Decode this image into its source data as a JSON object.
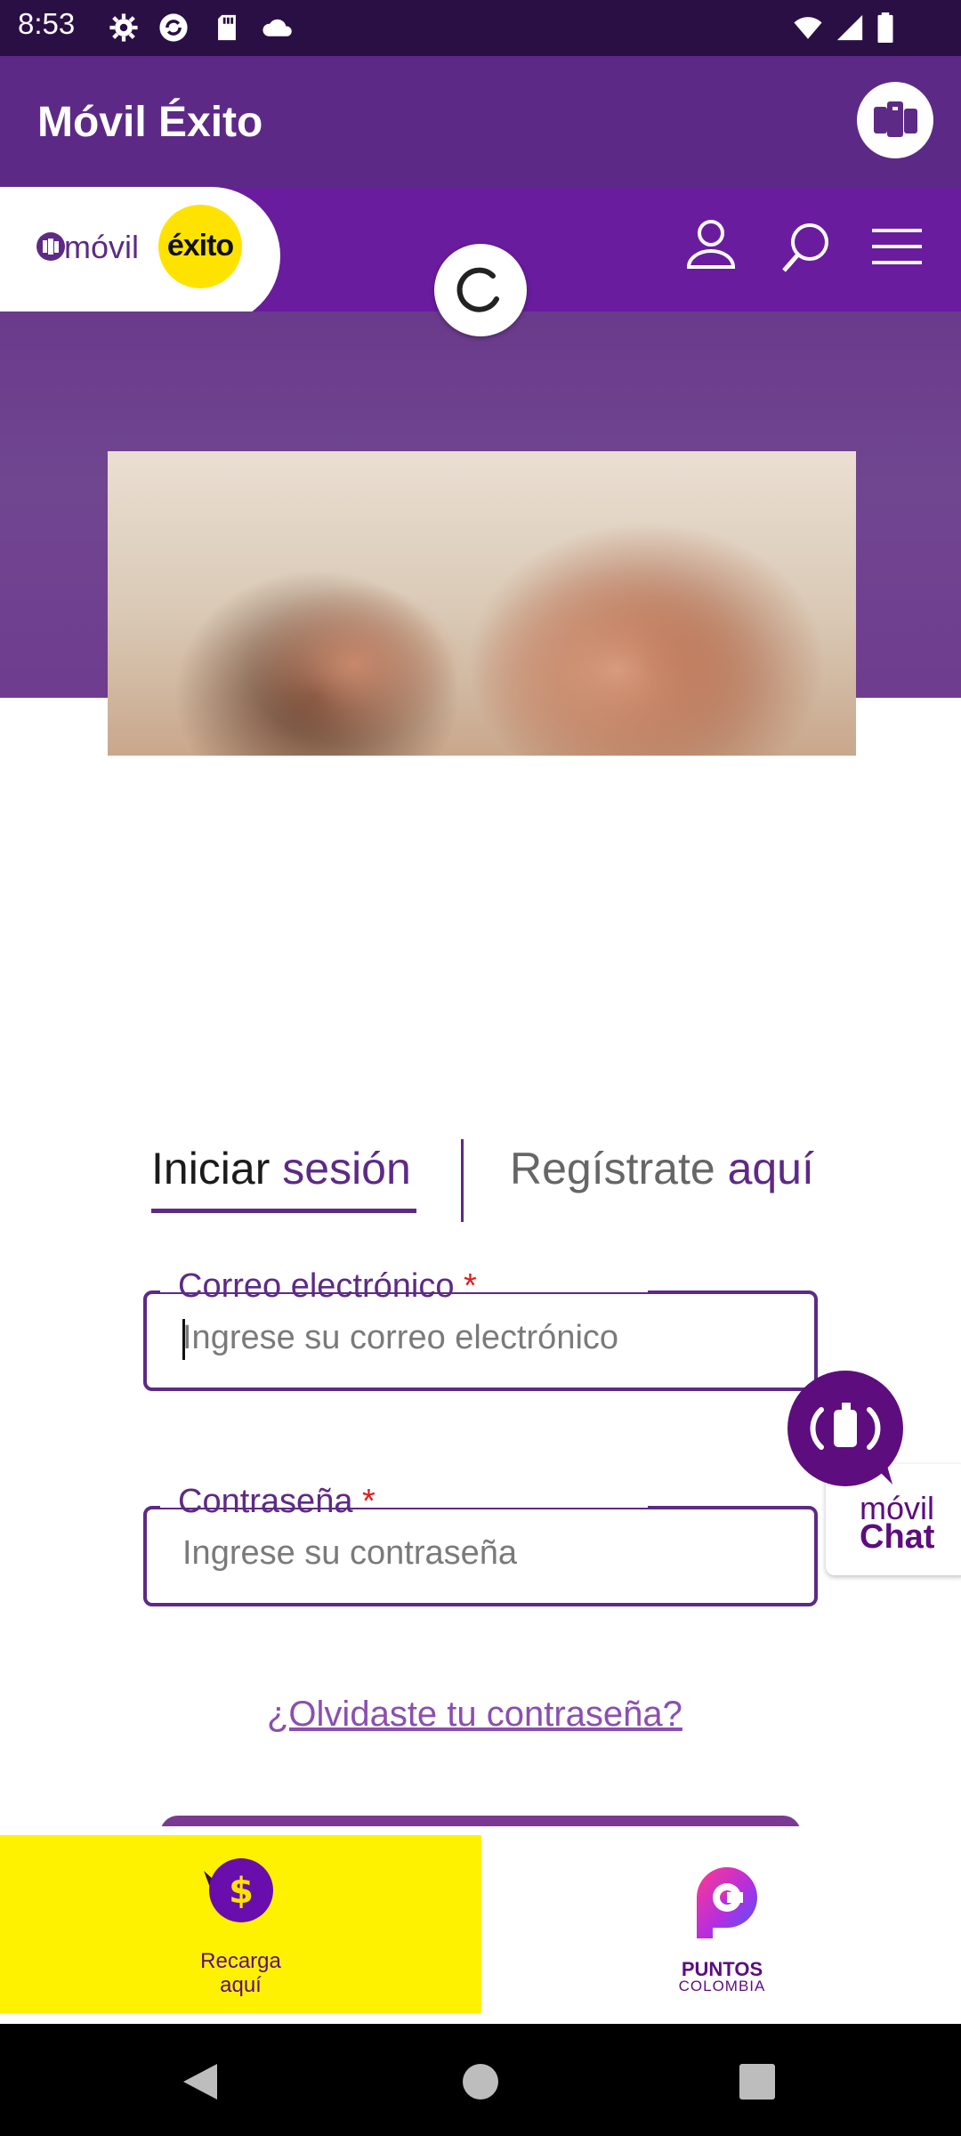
{
  "status_bar": {
    "time": "8:53",
    "left_icons": [
      "settings-icon",
      "sync-icon",
      "sd-card-icon",
      "cloud-icon"
    ],
    "right_icons": [
      "wifi-icon",
      "signal-icon",
      "battery-icon"
    ]
  },
  "app_bar": {
    "title": "Móvil Éxito",
    "action_icon": "phones-logo-icon"
  },
  "header": {
    "logo_movil": "móvil",
    "logo_exito": "éxito",
    "icons": [
      "user-icon",
      "search-icon",
      "menu-icon"
    ]
  },
  "tabs": {
    "login_part1": "Iniciar ",
    "login_part2": "sesión",
    "register_part1": "Regístrate ",
    "register_part2": "aquí",
    "active": "login"
  },
  "form": {
    "email_label": "Correo electrónico",
    "email_placeholder": "Ingrese su correo electrónico",
    "password_label": "Contraseña",
    "password_placeholder": "Ingrese su contraseña",
    "required_mark": "*",
    "forgot_password": "¿Olvidaste tu contraseña?"
  },
  "chat_widget": {
    "line1": "móvil",
    "line2": "Chat"
  },
  "bottom_banner": {
    "recarga_line1": "Recarga",
    "recarga_line2": "aquí",
    "puntos_line1": "PUNTOS",
    "puntos_line2": "COLOMBIA"
  },
  "nav_bar": {
    "icons": [
      "back-icon",
      "home-icon",
      "recents-icon"
    ]
  },
  "colors": {
    "brand_purple": "#5d2a86",
    "header_purple": "#6a1c9e",
    "exito_yellow": "#ffe300",
    "banner_yellow": "#fff200",
    "required_red": "#e01c1c"
  }
}
